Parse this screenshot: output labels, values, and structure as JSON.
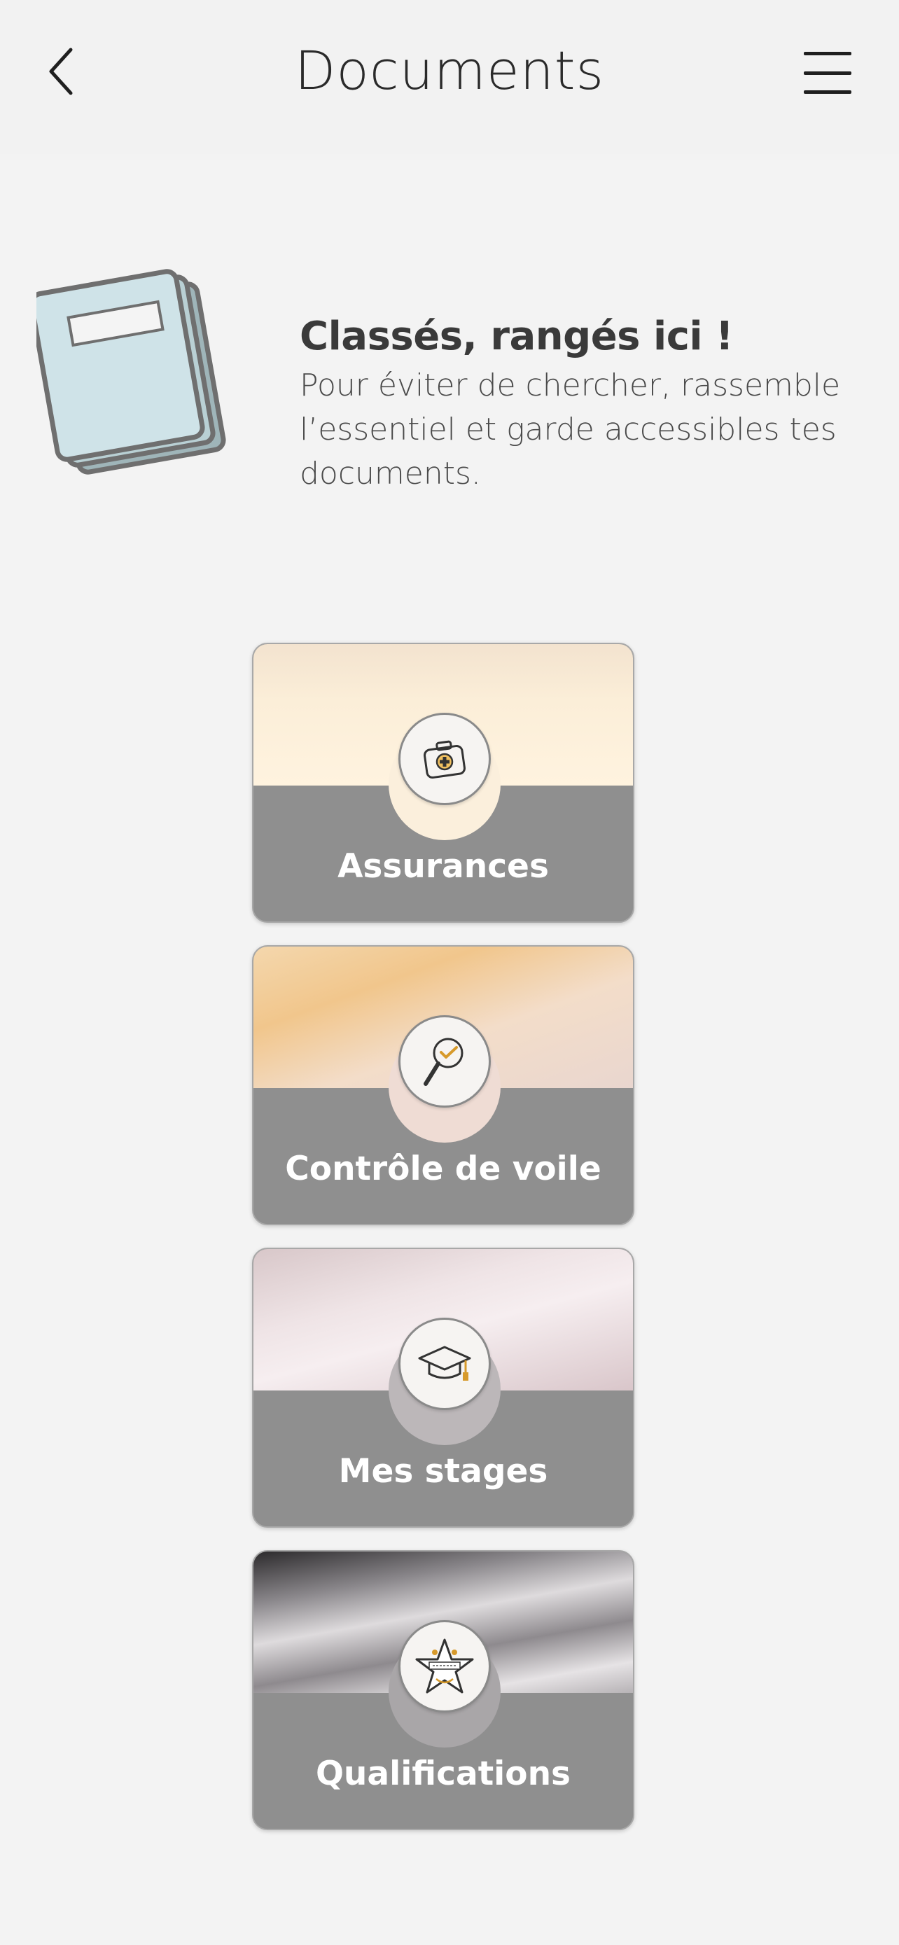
{
  "header": {
    "title": "Documents",
    "back_icon": "chevron-left-icon",
    "menu_icon": "hamburger-menu-icon"
  },
  "intro": {
    "heading": "Classés, rangés ici !",
    "body": "Pour éviter de chercher, rassemble l’essentiel et garde accessibles tes documents.",
    "illustration": "document-stack-icon"
  },
  "categories": [
    {
      "label": "Assurances",
      "icon": "medical-kit-icon"
    },
    {
      "label": "Contrôle de voile",
      "icon": "magnifier-check-icon"
    },
    {
      "label": "Mes stages",
      "icon": "graduation-cap-icon"
    },
    {
      "label": "Qualifications",
      "icon": "star-badge-icon"
    }
  ],
  "colors": {
    "background": "#f3f3f3",
    "card_bottom": "#8f8f8f",
    "accent": "#d79a2b",
    "illustration_fill": "#cfe3e8"
  }
}
